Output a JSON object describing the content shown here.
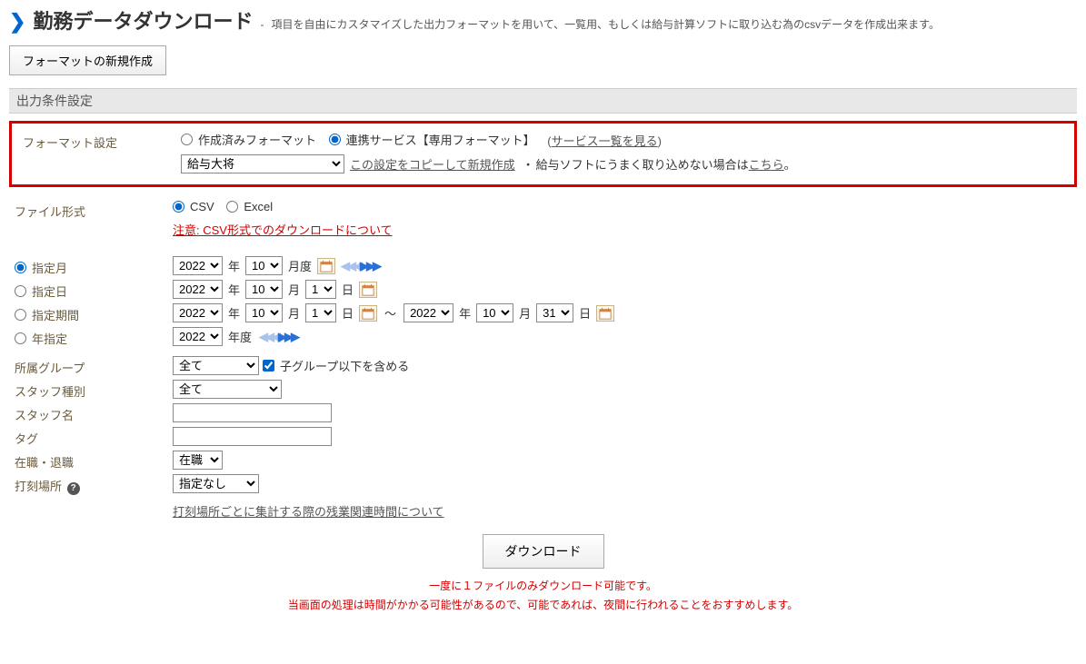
{
  "header": {
    "title": "勤務データダウンロード",
    "sep": "-",
    "desc": "項目を自由にカスタマイズした出力フォーマットを用いて、一覧用、もしくは給与計算ソフトに取り込む為のcsvデータを作成出来ます。"
  },
  "buttons": {
    "new_format": "フォーマットの新規作成",
    "download": "ダウンロード"
  },
  "section": {
    "title": "出力条件設定"
  },
  "format": {
    "label": "フォーマット設定",
    "opt_existing": "作成済みフォーマット",
    "opt_linked": "連携サービス【専用フォーマット】",
    "service_list_link": "サービス一覧を見る",
    "selected": "給与大将",
    "copy_link": "この設定をコピーして新規作成",
    "dot": "・",
    "help_prefix": "給与ソフトにうまく取り込めない場合は",
    "help_link": "こちら",
    "help_suffix": "。"
  },
  "filetype": {
    "label": "ファイル形式",
    "csv": "CSV",
    "excel": "Excel",
    "csv_warning": "注意: CSV形式でのダウンロードについて"
  },
  "period": {
    "opt_month": "指定月",
    "opt_day": "指定日",
    "opt_range": "指定期間",
    "opt_year": "年指定",
    "year_unit": "年",
    "month_unit": "月",
    "day_unit": "日",
    "monthly_unit": "月度",
    "yearly_unit": "年度",
    "tilde": "～",
    "month": {
      "year": "2022",
      "month": "10"
    },
    "day": {
      "year": "2022",
      "month": "10",
      "day": "1"
    },
    "range": {
      "from": {
        "year": "2022",
        "month": "10",
        "day": "1"
      },
      "to": {
        "year": "2022",
        "month": "10",
        "day": "31"
      }
    },
    "year_only": {
      "year": "2022"
    }
  },
  "group": {
    "label": "所属グループ",
    "selected": "全て",
    "include_sub": "子グループ以下を含める"
  },
  "staff_type": {
    "label": "スタッフ種別",
    "selected": "全て"
  },
  "staff_name": {
    "label": "スタッフ名",
    "value": ""
  },
  "tag": {
    "label": "タグ",
    "value": ""
  },
  "employment": {
    "label": "在職・退職",
    "selected": "在職"
  },
  "location": {
    "label": "打刻場所",
    "selected": "指定なし",
    "note_link": "打刻場所ごとに集計する際の残業関連時間について"
  },
  "footer": {
    "warn1": "一度に１ファイルのみダウンロード可能です。",
    "warn2": "当画面の処理は時間がかかる可能性があるので、可能であれば、夜間に行われることをおすすめします。"
  },
  "paren": {
    "open": "(",
    "close": ")"
  }
}
